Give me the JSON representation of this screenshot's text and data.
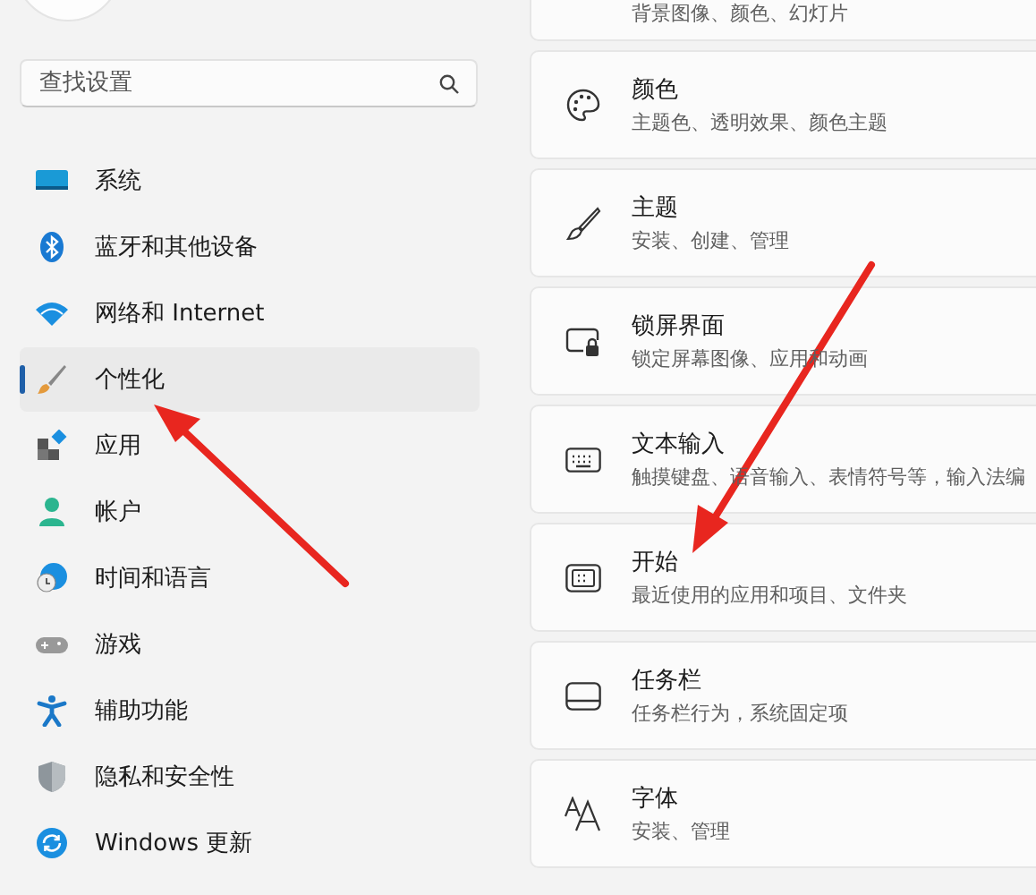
{
  "search": {
    "placeholder": "查找设置"
  },
  "nav_items": [
    {
      "label": "系统",
      "selected": false
    },
    {
      "label": "蓝牙和其他设备",
      "selected": false
    },
    {
      "label": "网络和 Internet",
      "selected": false
    },
    {
      "label": "个性化",
      "selected": true
    },
    {
      "label": "应用",
      "selected": false
    },
    {
      "label": "帐户",
      "selected": false
    },
    {
      "label": "时间和语言",
      "selected": false
    },
    {
      "label": "游戏",
      "selected": false
    },
    {
      "label": "辅助功能",
      "selected": false
    },
    {
      "label": "隐私和安全性",
      "selected": false
    },
    {
      "label": "Windows 更新",
      "selected": false
    }
  ],
  "settings_cards": [
    {
      "subtitle": "背景图像、颜色、幻灯片"
    },
    {
      "title": "颜色",
      "subtitle": "主题色、透明效果、颜色主题"
    },
    {
      "title": "主题",
      "subtitle": "安装、创建、管理"
    },
    {
      "title": "锁屏界面",
      "subtitle": "锁定屏幕图像、应用和动画"
    },
    {
      "title": "文本输入",
      "subtitle": "触摸键盘、语音输入、表情符号等，输入法编"
    },
    {
      "title": "开始",
      "subtitle": "最近使用的应用和项目、文件夹"
    },
    {
      "title": "任务栏",
      "subtitle": "任务栏行为，系统固定项"
    },
    {
      "title": "字体",
      "subtitle": "安装、管理"
    }
  ]
}
